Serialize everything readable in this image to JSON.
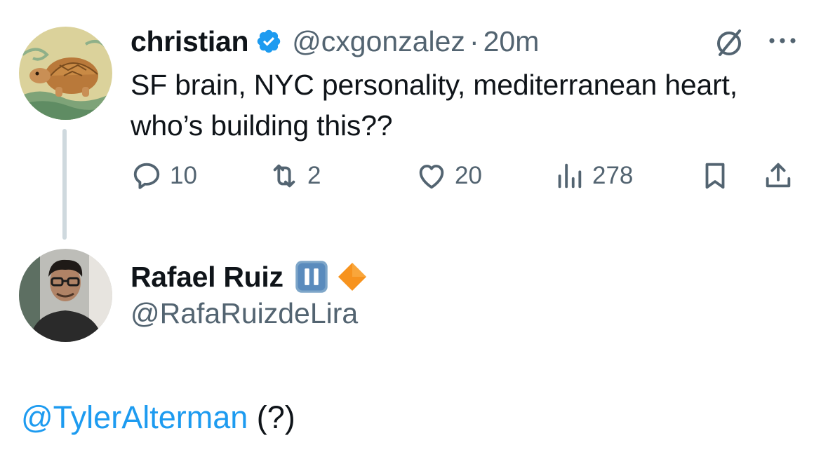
{
  "tweet": {
    "author": {
      "display_name": "christian",
      "handle": "@cxgonzalez",
      "verified": true,
      "avatar_icon": "tortoise-illustration"
    },
    "separator": "·",
    "time": "20m",
    "text_line_1": "SF brain, NYC personality, mediterranean heart,",
    "text_line_2": "who’s building this??",
    "actions": {
      "replies": "10",
      "reposts": "2",
      "likes": "20",
      "views": "278"
    }
  },
  "reply": {
    "author": {
      "display_name": "Rafael Ruiz",
      "handle": "@RafaRuizdeLira",
      "name_emojis": [
        "pause-button-emoji",
        "orange-diamond-emoji"
      ],
      "avatar_icon": "man-with-glasses-photo"
    },
    "mention": "@TylerAlterman",
    "text_suffix": " (?)"
  },
  "colors": {
    "text": "#0f1419",
    "secondary": "#536471",
    "link": "#1d9bf0",
    "verified": "#1d9bf0",
    "thread_line": "#cfd9de"
  }
}
